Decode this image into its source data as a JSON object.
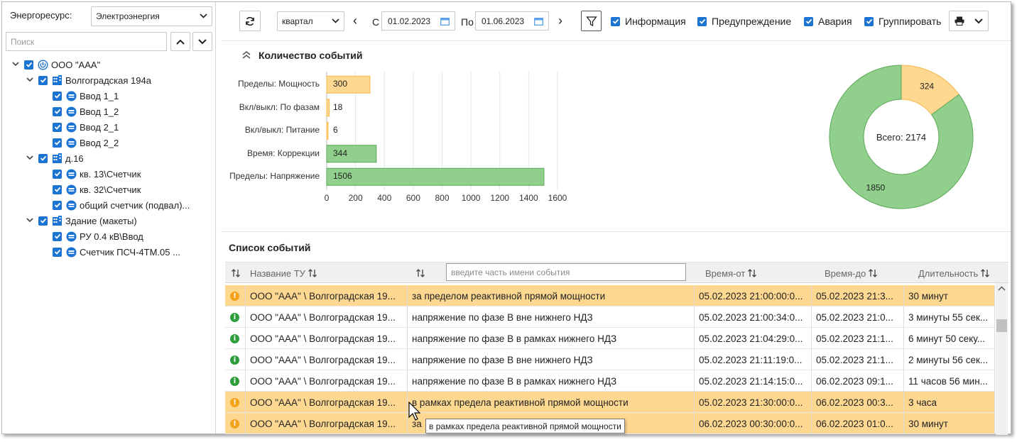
{
  "left": {
    "resource_label": "Энергоресурс:",
    "resource_value": "Электроэнергия",
    "search_placeholder": "Поиск",
    "tree": [
      {
        "label": "ООО \"ААА\"",
        "level": 0,
        "icon": "power-icon",
        "expander": true
      },
      {
        "label": "Волгоградская 194а",
        "level": 1,
        "icon": "building-icon",
        "expander": true
      },
      {
        "label": "Ввод 1_1",
        "level": 2,
        "icon": "meter-icon",
        "expander": false
      },
      {
        "label": "Ввод 1_2",
        "level": 2,
        "icon": "meter-icon",
        "expander": false
      },
      {
        "label": "Ввод 2_1",
        "level": 2,
        "icon": "meter-icon",
        "expander": false
      },
      {
        "label": "Ввод 2_2",
        "level": 2,
        "icon": "meter-icon",
        "expander": false
      },
      {
        "label": "д.16",
        "level": 1,
        "icon": "building-icon",
        "expander": true
      },
      {
        "label": "кв. 13\\Счетчик",
        "level": 2,
        "icon": "meter-icon",
        "expander": false
      },
      {
        "label": "кв. 32\\Счетчик",
        "level": 2,
        "icon": "meter-icon",
        "expander": false
      },
      {
        "label": "общий счетчик (подвал)...",
        "level": 2,
        "icon": "meter-icon",
        "expander": false
      },
      {
        "label": "Здание (макеты)",
        "level": 1,
        "icon": "building-icon",
        "expander": true
      },
      {
        "label": "РУ 0.4 кВ\\Ввод",
        "level": 2,
        "icon": "meter-icon",
        "expander": false
      },
      {
        "label": "Счетчик ПСЧ-4ТМ.05 ...",
        "level": 2,
        "icon": "meter-icon",
        "expander": false
      }
    ]
  },
  "toolbar": {
    "period": "квартал",
    "from_label": "С",
    "from_date": "01.02.2023",
    "to_label": "По",
    "to_date": "01.06.2023",
    "prev": "‹",
    "next": "›",
    "checks": {
      "info": "Информация",
      "warning": "Предупреждение",
      "alarm": "Авария",
      "group": "Группировать"
    }
  },
  "events_section": {
    "title": "Количество событий",
    "list_title": "Список событий"
  },
  "colors": {
    "warn_fill": "#fed891",
    "warn_stroke": "#f4b84a",
    "ok_fill": "#90d08c",
    "ok_stroke": "#5aa855",
    "accent": "#1b74d1",
    "info_icon": "#2e9d3c",
    "warn_icon": "#f3a21b"
  },
  "chart_data": [
    {
      "type": "bar",
      "orientation": "horizontal",
      "categories": [
        "Пределы: Мощность",
        "Вкл/выкл: По фазам",
        "Вкл/выкл: Питание",
        "Время: Коррекции",
        "Пределы: Напряжение"
      ],
      "values": [
        300,
        18,
        6,
        344,
        1506
      ],
      "bar_colors": [
        "#fed891",
        "#fed891",
        "#fed891",
        "#90d08c",
        "#90d08c"
      ],
      "xlim": [
        0,
        1600
      ],
      "xticks": [
        "0",
        "200",
        "400",
        "600",
        "800",
        "1000",
        "1200",
        "1400",
        "1600"
      ],
      "grid": true
    },
    {
      "type": "pie",
      "donut": true,
      "center_label": "Всего: 2174",
      "slices": [
        {
          "value": 324,
          "label": "324",
          "color": "#fed891"
        },
        {
          "value": 1850,
          "label": "1850",
          "color": "#90d08c"
        }
      ]
    }
  ],
  "table": {
    "headers": {
      "name": "Название ТУ",
      "from": "Время-от",
      "to": "Время-до",
      "duration": "Длительность"
    },
    "filter_placeholder": "введите часть имени события",
    "rows": [
      {
        "type": "warn",
        "name": "ООО \"ААА\" \\ Волгоградская 19...",
        "event": "за пределом реактивной прямой мощности",
        "from": "05.02.2023 21:00:00:0...",
        "to": "05.02.2023 21:3...",
        "duration": "30 минут"
      },
      {
        "type": "info",
        "name": "ООО \"ААА\" \\ Волгоградская 19...",
        "event": "напряжение по фазе B вне нижнего НДЗ",
        "from": "05.02.2023 21:00:34:0...",
        "to": "05.02.2023 21:0...",
        "duration": "3 минуты 55 сек..."
      },
      {
        "type": "info",
        "name": "ООО \"ААА\" \\ Волгоградская 19...",
        "event": "напряжение по фазе B в рамках нижнего НДЗ",
        "from": "05.02.2023 21:04:29:0...",
        "to": "05.02.2023 21:1...",
        "duration": "6 минут 50 секу..."
      },
      {
        "type": "info",
        "name": "ООО \"ААА\" \\ Волгоградская 19...",
        "event": "напряжение по фазе B вне нижнего НДЗ",
        "from": "05.02.2023 21:11:19:0...",
        "to": "05.02.2023 21:1...",
        "duration": "2 минуты 56 сек..."
      },
      {
        "type": "info",
        "name": "ООО \"ААА\" \\ Волгоградская 19...",
        "event": "напряжение по фазе B в рамках нижнего НДЗ",
        "from": "05.02.2023 21:14:15:0...",
        "to": "06.02.2023 09:1...",
        "duration": "11 часов 56 мин..."
      },
      {
        "type": "warn",
        "name": "ООО \"ААА\" \\ Волгоградская 19...",
        "event": "в рамках предела реактивной прямой мощности",
        "from": "05.02.2023 21:30:00:0...",
        "to": "06.02.2023 00:3...",
        "duration": "3 часа"
      },
      {
        "type": "warn",
        "name": "ООО \"ААА\" \\ Волгоградская 19...",
        "event": "за",
        "from": "06.02.2023 00:30:00:0...",
        "to": "06.02.2023 01:0...",
        "duration": "30 минут"
      }
    ],
    "tooltip": "в рамках предела реактивной прямой мощности"
  }
}
